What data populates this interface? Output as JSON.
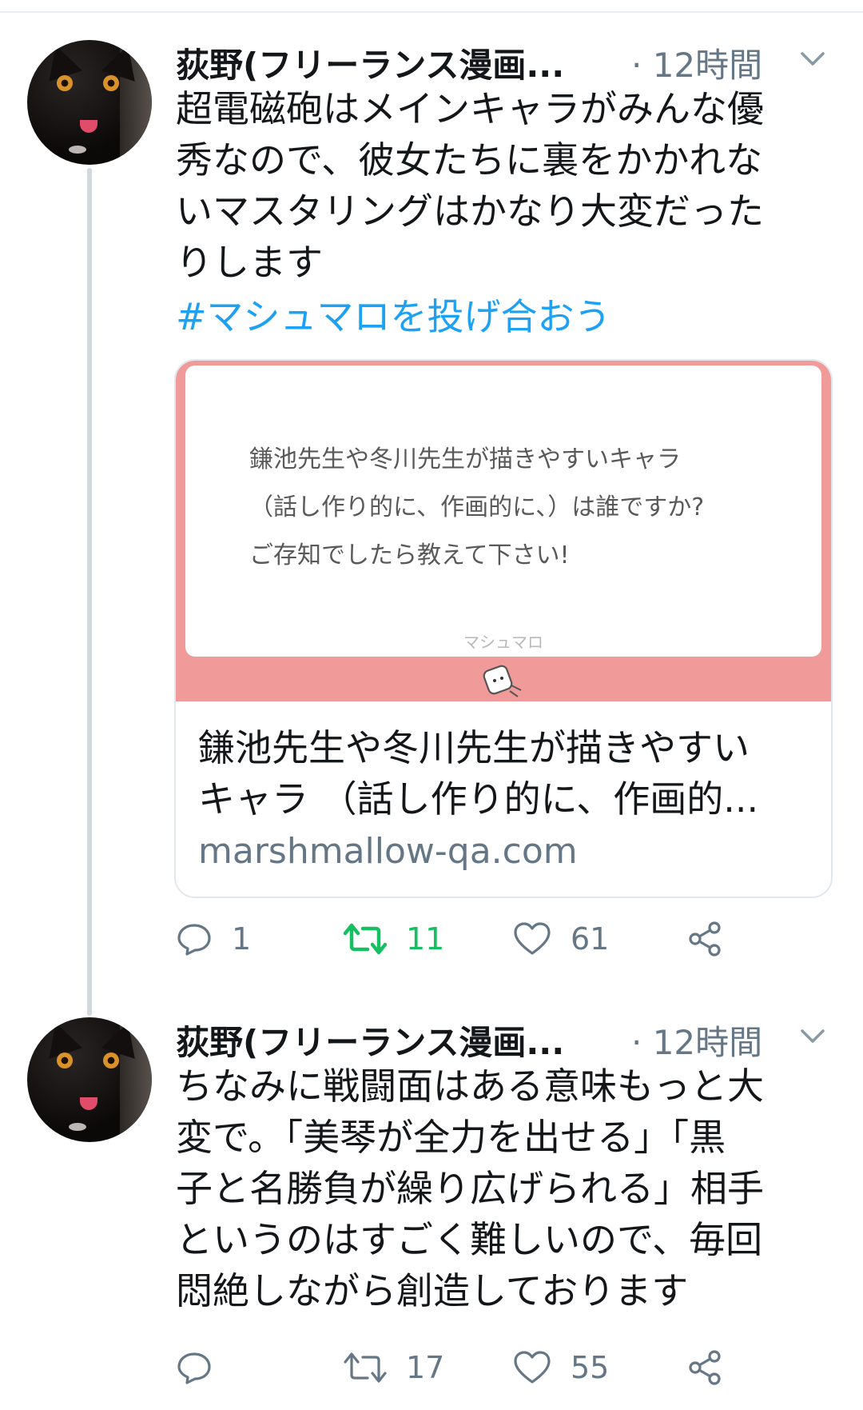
{
  "tweets": [
    {
      "author": "荻野(フリーランス漫画...",
      "time": "· 12時間",
      "text_lines": [
        "超電磁砲はメインキャラがみんな優",
        "秀なので、彼女たちに裏をかかれな",
        "いマスタリングはかなり大変だった",
        "りします"
      ],
      "hashtag": "#マシュマロを投げ合おう",
      "card": {
        "question_lines": [
          "鎌池先生や冬川先生が描きやすいキャラ",
          "（話し作り的に、作画的に、）は誰ですか?",
          "ご存知でしたら教えて下さい!"
        ],
        "brand": "マシュマロ",
        "title_lines": [
          "鎌池先生や冬川先生が描きやすい",
          "キャラ （話し作り的に、作画的..."
        ],
        "domain": "marshmallow-qa.com"
      },
      "replies": "1",
      "retweets": "11",
      "likes": "61",
      "retweeted": true
    },
    {
      "author": "荻野(フリーランス漫画...",
      "time": "· 12時間",
      "text_lines": [
        "ちなみに戦闘面はある意味もっと大",
        "変で。「美琴が全力を出せる」「黒",
        "子と名勝負が繰り広げられる」相手",
        "というのはすごく難しいので、毎回",
        "悶絶しながら創造しております"
      ],
      "replies": "",
      "retweets": "17",
      "likes": "55",
      "retweeted": false
    }
  ],
  "colors": {
    "link": "#1da1f2",
    "retweet_active": "#17bf63",
    "meta": "#657786",
    "card_accent": "#f09b9a"
  },
  "icons": [
    "reply-icon",
    "retweet-icon",
    "like-icon",
    "share-icon",
    "chevron-down-icon",
    "marshmallow-icon"
  ]
}
